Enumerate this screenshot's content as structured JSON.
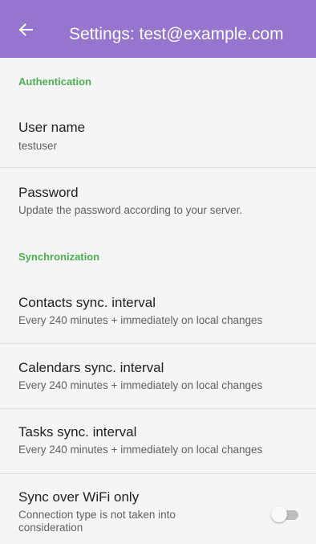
{
  "app_bar": {
    "title": "Settings: test@example.com",
    "background": "#9575cd",
    "back_icon": "arrow-back-icon"
  },
  "sections": {
    "authentication": "Authentication",
    "synchronization": "Synchronization"
  },
  "accent_color": "#4caf50",
  "prefs": {
    "username": {
      "title": "User name",
      "summary": "testuser"
    },
    "password": {
      "title": "Password",
      "summary": "Update the password according to your server."
    },
    "contacts": {
      "title": "Contacts sync. interval",
      "summary": "Every 240 minutes + immediately on local changes"
    },
    "calendars": {
      "title": "Calendars sync. interval",
      "summary": "Every 240 minutes + immediately on local changes"
    },
    "tasks": {
      "title": "Tasks sync. interval",
      "summary": "Every 240 minutes + immediately on local changes"
    },
    "wifi": {
      "title": "Sync over WiFi only",
      "summary_line1": "Connection type is not taken into",
      "summary_line2": "consideration",
      "enabled": false
    }
  }
}
